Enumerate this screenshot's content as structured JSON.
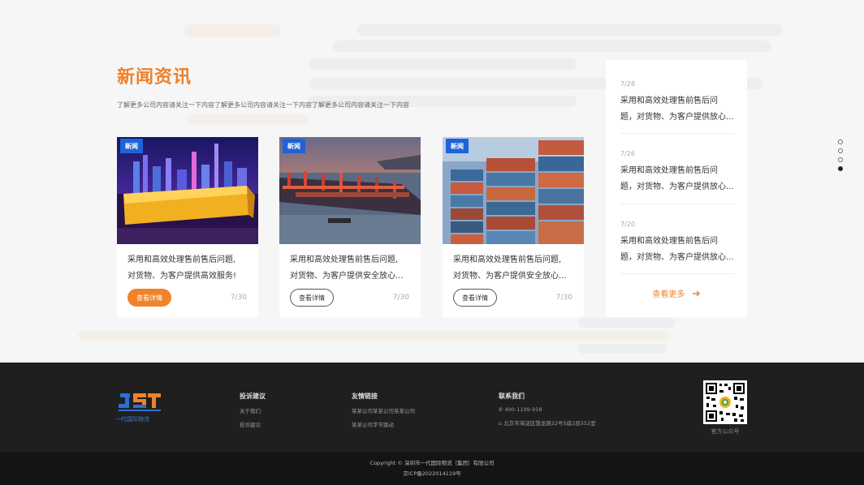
{
  "news": {
    "title": "新闻资讯",
    "subtitle": "了解更多公司内容请关注一下内容了解更多公司内容请关注一下内容了解更多公司内容请关注一下内容",
    "cards": [
      {
        "tag": "新闻",
        "line1": "采用和高效处理售前售后问题,",
        "line2": "对货物、为客户提供高效服务!",
        "button": "查看详情",
        "date": "7/30"
      },
      {
        "tag": "新闻",
        "line1": "采用和高效处理售前售后问题,",
        "line2": "对货物、为客户提供安全放心...",
        "button": "查看详情",
        "date": "7/30"
      },
      {
        "tag": "新闻",
        "line1": "采用和高效处理售前售后问题,",
        "line2": "对货物、为客户提供安全放心...",
        "button": "查看详情",
        "date": "7/30"
      }
    ],
    "side": [
      {
        "date": "7/28",
        "line1": "采用和高效处理售前售后问",
        "line2": "题，对货物、为客户提供放心..."
      },
      {
        "date": "7/26",
        "line1": "采用和高效处理售前售后问",
        "line2": "题，对货物、为客户提供放心..."
      },
      {
        "date": "7/20",
        "line1": "采用和高效处理售前售后问",
        "line2": "题，对货物、为客户提供放心..."
      }
    ],
    "more": "查看更多",
    "more_icon": "arrow-right-icon"
  },
  "footer": {
    "logo_caption": "一代国际物流",
    "complaints": {
      "title": "投诉建议",
      "links": [
        "关于我们",
        "投诉建议"
      ]
    },
    "friends": {
      "title": "友情链接",
      "links": [
        "某某公司某某公司某某公司",
        "某某公司字节跳动"
      ]
    },
    "contact": {
      "title": "联系我们",
      "phone": "400-1199-918",
      "address": "北京市海淀区饿龙路22号S座2层552室"
    },
    "qr_caption": "官方公众号"
  },
  "copyright": {
    "line1": "Copyright © 深圳市一代国际物流（集团）有限公司",
    "line2": "京ICP备2022014119号"
  },
  "colors": {
    "accent": "#f0802a",
    "tag_blue": "#1e63d8",
    "footer_bg": "#1f1f1f"
  }
}
